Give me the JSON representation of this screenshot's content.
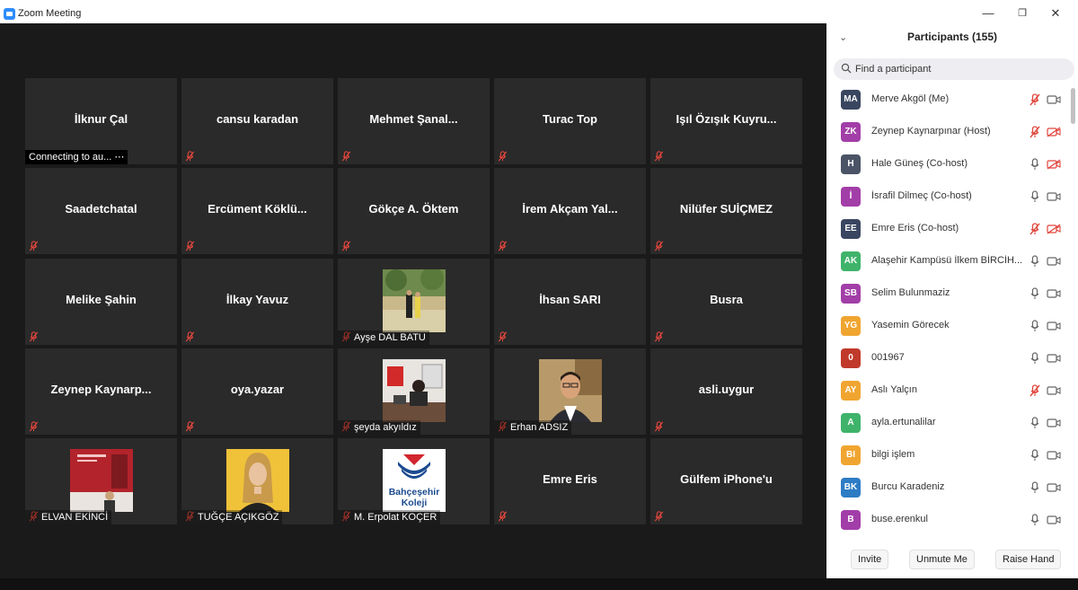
{
  "window": {
    "title": "Zoom Meeting",
    "minimize": "—",
    "maximize": "❐",
    "close": "✕"
  },
  "tiles": [
    {
      "name": "İlknur Çal",
      "status": "Connecting to au... ⋯",
      "label": ""
    },
    {
      "name": "cansu karadan",
      "label": ""
    },
    {
      "name": "Mehmet  Şanal...",
      "label": ""
    },
    {
      "name": "Turac Top",
      "label": ""
    },
    {
      "name": "Işıl Özışık Kuyru...",
      "label": ""
    },
    {
      "name": "Saadetchatal",
      "label": ""
    },
    {
      "name": "Ercüment  Köklü...",
      "label": ""
    },
    {
      "name": "Gökçe A. Öktem",
      "label": ""
    },
    {
      "name": "İrem Akçam Yal...",
      "label": ""
    },
    {
      "name": "Nilüfer SUİÇMEZ",
      "label": ""
    },
    {
      "name": "Melike Şahin",
      "label": ""
    },
    {
      "name": "İlkay Yavuz",
      "label": ""
    },
    {
      "name": "",
      "label": "Ayşe DAL BATU",
      "photo": "park"
    },
    {
      "name": "İhsan  SARI",
      "label": ""
    },
    {
      "name": "Busra",
      "label": ""
    },
    {
      "name": "Zeynep  Kaynarp...",
      "label": ""
    },
    {
      "name": "oya.yazar",
      "label": ""
    },
    {
      "name": "",
      "label": "şeyda akyıldız",
      "photo": "office"
    },
    {
      "name": "",
      "label": "Erhan ADSIZ",
      "photo": "portrait"
    },
    {
      "name": "asli.uygur",
      "label": ""
    },
    {
      "name": "",
      "label": "ELVAN EKİNCİ",
      "photo": "poster"
    },
    {
      "name": "",
      "label": "TUĞÇE AÇIKGÖZ",
      "photo": "woman"
    },
    {
      "name": "",
      "label": "M. Erpolat KOÇER",
      "photo": "logo",
      "logo_text": [
        "Bahçeşehir",
        "Koleji"
      ]
    },
    {
      "name": "Emre Eris",
      "label": ""
    },
    {
      "name": "Gülfem  iPhone'u",
      "label": ""
    }
  ],
  "panel": {
    "title": "Participants (155)",
    "search_placeholder": "Find a participant",
    "participants": [
      {
        "initials": "MA",
        "name": "Merve Akgöl (Me)",
        "color": "#3a4660",
        "mic": "muted",
        "cam": "on"
      },
      {
        "initials": "ZK",
        "name": "Zeynep Kaynarpınar (Host)",
        "color": "#a23ea8",
        "mic": "muted",
        "cam": "off"
      },
      {
        "initials": "H",
        "name": "Hale Güneş (Co-host)",
        "color": "#4a5466",
        "mic": "on",
        "cam": "off"
      },
      {
        "initials": "İ",
        "name": "İsrafil Dilmeç (Co-host)",
        "color": "#a23ea8",
        "mic": "on",
        "cam": "on"
      },
      {
        "initials": "EE",
        "name": "Emre Eris (Co-host)",
        "color": "#3a4660",
        "mic": "muted",
        "cam": "off"
      },
      {
        "initials": "AK",
        "name": "Alaşehir Kampüsü İlkem BİRCİH...",
        "color": "#3fb36a",
        "mic": "on",
        "cam": "on"
      },
      {
        "initials": "SB",
        "name": "Selim Bulunmaziz",
        "color": "#a23ea8",
        "mic": "on",
        "cam": "on"
      },
      {
        "initials": "YG",
        "name": "Yasemin Görecek",
        "color": "#f0a530",
        "mic": "on",
        "cam": "on"
      },
      {
        "initials": "0",
        "name": "001967",
        "color": "#c0392b",
        "mic": "on",
        "cam": "on"
      },
      {
        "initials": "AY",
        "name": "Aslı Yalçın",
        "color": "#f0a530",
        "mic": "muted",
        "cam": "on"
      },
      {
        "initials": "A",
        "name": "ayla.ertunalilar",
        "color": "#3fb36a",
        "mic": "on",
        "cam": "on"
      },
      {
        "initials": "BI",
        "name": "bilgi işlem",
        "color": "#f0a530",
        "mic": "on",
        "cam": "on"
      },
      {
        "initials": "BK",
        "name": "Burcu Karadeniz",
        "color": "#2d7cc4",
        "mic": "on",
        "cam": "on"
      },
      {
        "initials": "B",
        "name": "buse.erenkul",
        "color": "#a23ea8",
        "mic": "on",
        "cam": "on"
      }
    ],
    "buttons": {
      "invite": "Invite",
      "unmute": "Unmute Me",
      "raise": "Raise Hand"
    }
  }
}
